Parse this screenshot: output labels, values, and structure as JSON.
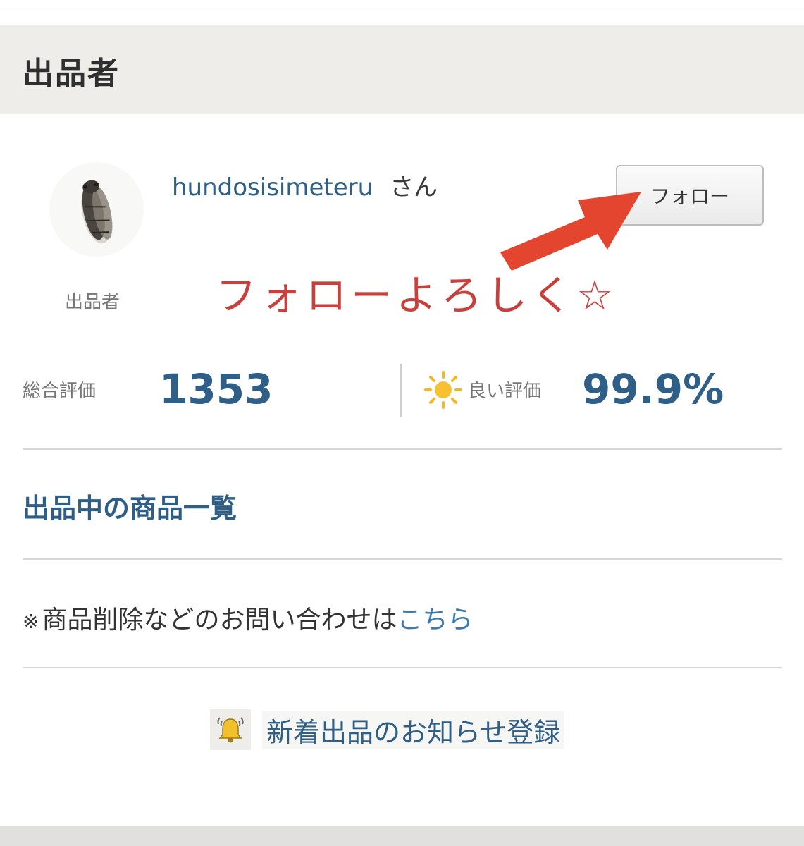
{
  "section": {
    "title": "出品者"
  },
  "seller": {
    "name": "hundosisimeteru",
    "suffix": "さん",
    "role_label": "出品者"
  },
  "follow": {
    "label": "フォロー"
  },
  "annotation": {
    "text": "フォローよろしく☆",
    "color": "#c8403c"
  },
  "ratings": {
    "total_label": "総合評価",
    "total_value": "1353",
    "good_label": "良い評価",
    "good_value": "99.9%"
  },
  "links": {
    "listings": "出品中の商品一覧",
    "contact_mark": "※",
    "contact_text": "商品削除などのお問い合わせは",
    "contact_link": "こちら",
    "notify": "新着出品のお知らせ登録"
  },
  "icons": {
    "avatar": "cicada-avatar-icon",
    "rating": "sun-icon",
    "notify": "bell-icon",
    "annotation": "arrow-icon"
  },
  "colors": {
    "accent_blue": "#2f5f86",
    "link_blue": "#3b7bb0",
    "header_bg": "#eeedea"
  }
}
